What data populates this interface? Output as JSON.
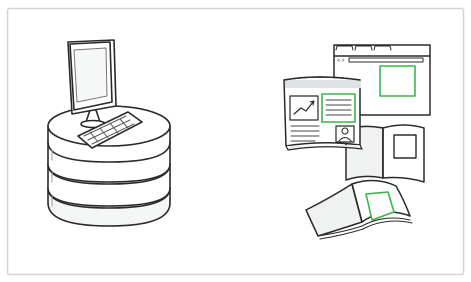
{
  "colors": {
    "frame": "#d4d4d4",
    "ink": "#2a2a2a",
    "accent": "#3bb54a",
    "paper": "#ffffff",
    "light_fill": "#f0f2f2"
  },
  "illustrations": {
    "left": "computer-on-database-icon",
    "right": "documents-and-publications-icon"
  }
}
